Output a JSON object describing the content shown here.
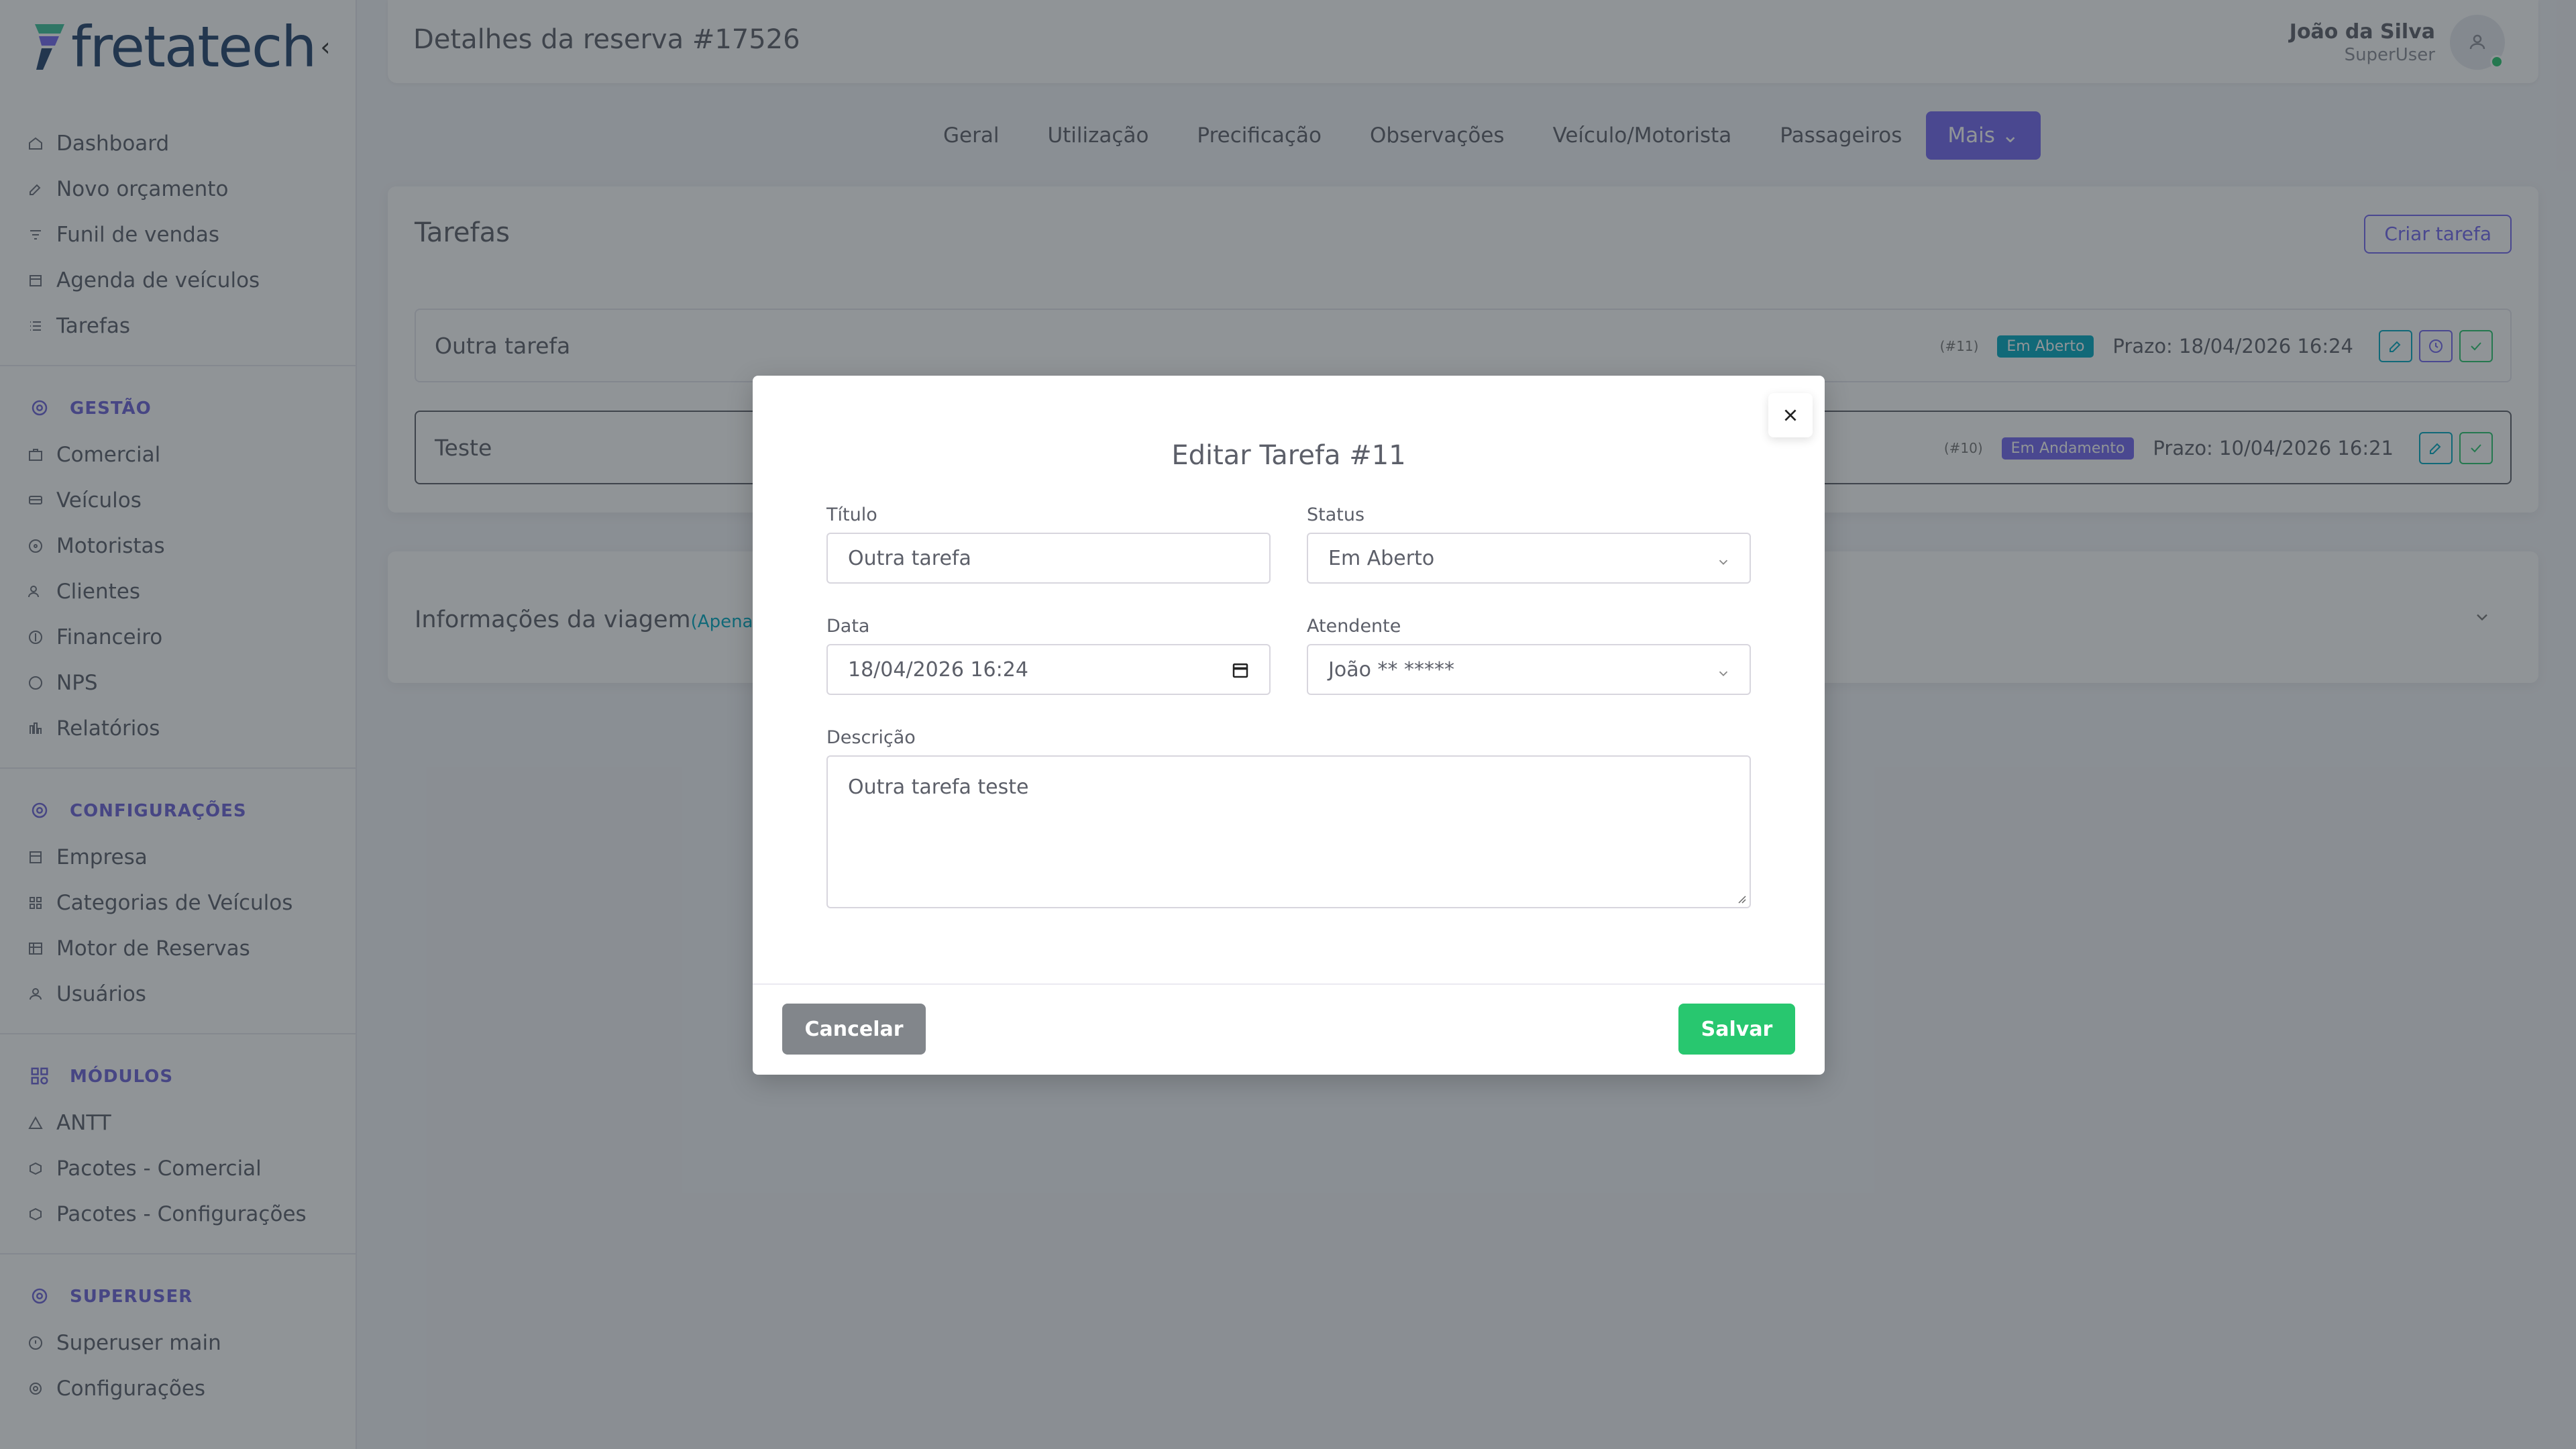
{
  "brand": {
    "name_part1": "freta",
    "name_part2": "tech"
  },
  "sidebar": {
    "main_items": [
      {
        "label": "Dashboard",
        "icon": "home-icon"
      },
      {
        "label": "Novo orçamento",
        "icon": "edit-icon"
      },
      {
        "label": "Funil de vendas",
        "icon": "funnel-icon"
      },
      {
        "label": "Agenda de veículos",
        "icon": "calendar-icon"
      },
      {
        "label": "Tarefas",
        "icon": "list-icon"
      }
    ],
    "sections": [
      {
        "title": "GESTÃO",
        "items": [
          "Comercial",
          "Veículos",
          "Motoristas",
          "Clientes",
          "Financeiro",
          "NPS",
          "Relatórios"
        ]
      },
      {
        "title": "CONFIGURAÇÕES",
        "items": [
          "Empresa",
          "Categorias de Veículos",
          "Motor de Reservas",
          "Usuários"
        ]
      },
      {
        "title": "MÓDULOS",
        "items": [
          "ANTT",
          "Pacotes - Comercial",
          "Pacotes - Configurações"
        ]
      },
      {
        "title": "SUPERUSER",
        "items": [
          "Superuser main",
          "Configurações"
        ]
      }
    ]
  },
  "header": {
    "title": "Detalhes da reserva #17526",
    "user_name": "João da Silva",
    "user_role": "SuperUser"
  },
  "tabs": [
    "Geral",
    "Utilização",
    "Precificação",
    "Observações",
    "Veículo/Motorista",
    "Passageiros",
    "Mais"
  ],
  "tasks": {
    "title": "Tarefas",
    "create_label": "Criar tarefa",
    "rows": [
      {
        "title": "Outra tarefa",
        "id": "(#11)",
        "status": "Em Aberto",
        "due": "Prazo: 18/04/2026 16:24"
      },
      {
        "title": "Teste",
        "id": "(#10)",
        "status": "Em Andamento",
        "due": "Prazo: 10/04/2026 16:21"
      }
    ]
  },
  "trip": {
    "title": "Informações da viagem",
    "note": "(Apenas su"
  },
  "modal": {
    "title": "Editar Tarefa #11",
    "title_label": "Título",
    "title_value": "Outra tarefa",
    "status_label": "Status",
    "status_value": "Em Aberto",
    "date_label": "Data",
    "date_value": "18/04/2026 16:24",
    "attendant_label": "Atendente",
    "attendant_value": "João ** *****",
    "description_label": "Descrição",
    "description_value": "Outra tarefa teste",
    "cancel_label": "Cancelar",
    "save_label": "Salvar"
  },
  "colors": {
    "primary": "#7367f0",
    "success": "#28c76f",
    "info": "#00a8c0",
    "secondary": "#82868b"
  }
}
